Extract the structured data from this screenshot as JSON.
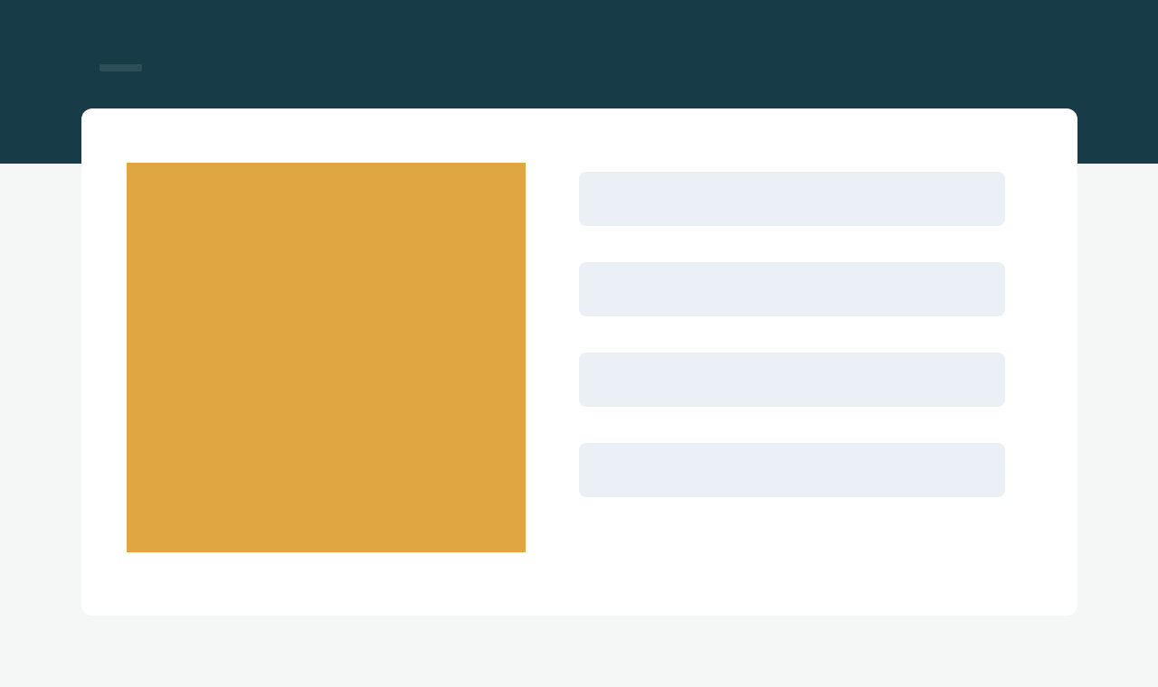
{
  "header": {
    "label": {
      "kind": "skeleton"
    }
  },
  "card": {
    "media": {
      "kind": "placeholder"
    },
    "lines": [
      {
        "kind": "skeleton"
      },
      {
        "kind": "skeleton"
      },
      {
        "kind": "skeleton"
      },
      {
        "kind": "skeleton"
      }
    ]
  }
}
